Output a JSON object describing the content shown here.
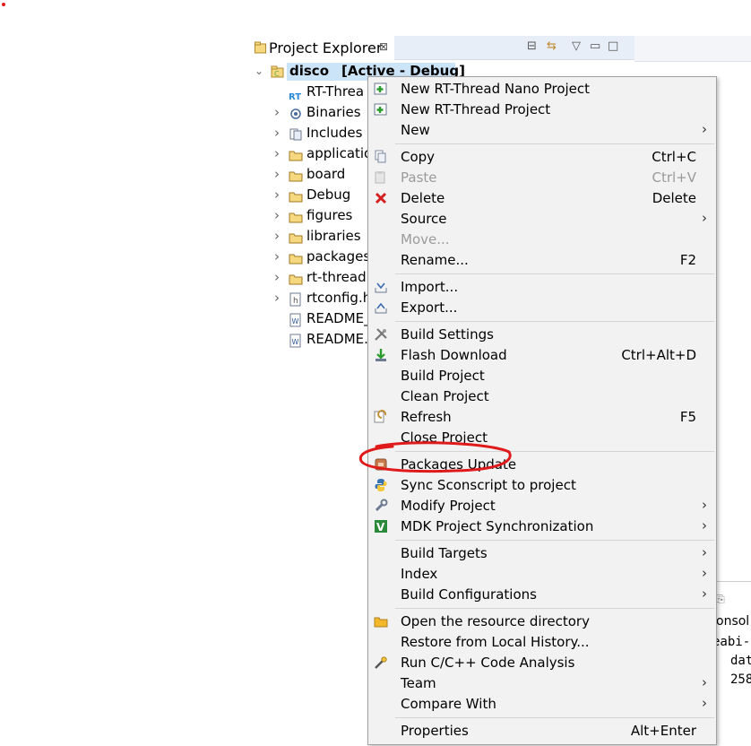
{
  "explorer": {
    "tab_title": "Project Explorer",
    "close_glyph": "⊠",
    "project": {
      "name": "disco",
      "state": "[Active - Debug]"
    },
    "items": [
      {
        "label": "RT-Threa",
        "icon": "rt-thread-icon",
        "expandable": false
      },
      {
        "label": "Binaries",
        "icon": "binaries-icon",
        "expandable": true
      },
      {
        "label": "Includes",
        "icon": "includes-icon",
        "expandable": true
      },
      {
        "label": "applicatio",
        "icon": "folder-icon",
        "expandable": true
      },
      {
        "label": "board",
        "icon": "folder-icon",
        "expandable": true
      },
      {
        "label": "Debug",
        "icon": "folder-icon",
        "expandable": true
      },
      {
        "label": "figures",
        "icon": "folder-icon",
        "expandable": true
      },
      {
        "label": "libraries",
        "icon": "folder-icon",
        "expandable": true
      },
      {
        "label": "packages",
        "icon": "folder-icon",
        "expandable": true
      },
      {
        "label": "rt-thread",
        "icon": "folder-icon",
        "expandable": true
      },
      {
        "label": "rtconfig.h",
        "icon": "header-file-icon",
        "expandable": true
      },
      {
        "label": "README_",
        "icon": "word-file-icon",
        "expandable": false
      },
      {
        "label": "README.",
        "icon": "word-file-icon",
        "expandable": false
      }
    ]
  },
  "console": {
    "tab_fragment": "onsol",
    "lines": [
      "eabi-",
      "dat",
      "258"
    ]
  },
  "menu": {
    "items": [
      {
        "label": "New RT-Thread Nano Project",
        "icon": "new-project-icon"
      },
      {
        "label": "New RT-Thread Project",
        "icon": "new-project-icon"
      },
      {
        "label": "New",
        "submenu": true
      },
      {
        "sep": true
      },
      {
        "label": "Copy",
        "shortcut": "Ctrl+C",
        "icon": "copy-icon"
      },
      {
        "label": "Paste",
        "shortcut": "Ctrl+V",
        "icon": "paste-icon",
        "disabled": true
      },
      {
        "label": "Delete",
        "shortcut": "Delete",
        "icon": "delete-icon"
      },
      {
        "label": "Source",
        "submenu": true
      },
      {
        "label": "Move...",
        "disabled": true
      },
      {
        "label": "Rename...",
        "shortcut": "F2"
      },
      {
        "sep": true
      },
      {
        "label": "Import...",
        "icon": "import-icon"
      },
      {
        "label": "Export...",
        "icon": "export-icon"
      },
      {
        "sep": true
      },
      {
        "label": "Build Settings",
        "icon": "build-settings-icon"
      },
      {
        "label": "Flash Download",
        "shortcut": "Ctrl+Alt+D",
        "icon": "flash-download-icon"
      },
      {
        "label": "Build Project"
      },
      {
        "label": "Clean Project"
      },
      {
        "label": "Refresh",
        "shortcut": "F5",
        "icon": "refresh-icon"
      },
      {
        "label": "Close Project"
      },
      {
        "sep": true
      },
      {
        "label": "Packages Update",
        "icon": "packages-update-icon"
      },
      {
        "label": "Sync Sconscript to project",
        "icon": "python-icon"
      },
      {
        "label": "Modify Project",
        "submenu": true,
        "icon": "wrench-icon"
      },
      {
        "label": "MDK Project Synchronization",
        "submenu": true,
        "icon": "mdk-icon"
      },
      {
        "sep": true
      },
      {
        "label": "Build Targets",
        "submenu": true
      },
      {
        "label": "Index",
        "submenu": true
      },
      {
        "label": "Build Configurations",
        "submenu": true
      },
      {
        "sep": true
      },
      {
        "label": "Open the resource directory",
        "icon": "open-folder-icon"
      },
      {
        "label": "Restore from Local History..."
      },
      {
        "label": "Run C/C++ Code Analysis",
        "icon": "code-analysis-icon"
      },
      {
        "label": "Team",
        "submenu": true
      },
      {
        "label": "Compare With",
        "submenu": true
      },
      {
        "sep": true
      },
      {
        "label": "Properties",
        "shortcut": "Alt+Enter"
      }
    ]
  },
  "colors": {
    "annotation": "#e01a1a",
    "menu_bg": "#f2f2f2",
    "selection": "#cce4f7"
  }
}
